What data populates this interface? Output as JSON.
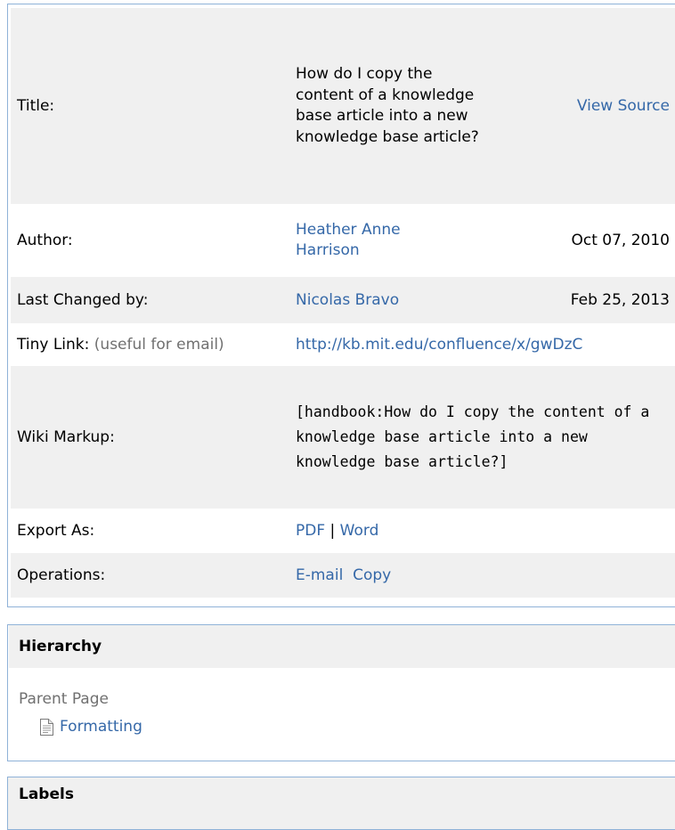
{
  "info": {
    "title_label": "Title:",
    "title_value": "How do I copy the content of a knowledge base article into a new knowledge base article?",
    "view_source": "View Source",
    "author_label": "Author:",
    "author_name": "Heather Anne Harrison",
    "author_date": "Oct 07, 2010",
    "changed_label": "Last Changed by:",
    "changed_name": "Nicolas Bravo",
    "changed_date": "Feb 25, 2013",
    "tiny_label": "Tiny Link:",
    "tiny_hint": "(useful for email)",
    "tiny_url": "http://kb.mit.edu/confluence/x/gwDzC",
    "wiki_label": "Wiki Markup:",
    "wiki_value": "[handbook:How do I copy the content of a knowledge base article into a new knowledge base article?]",
    "export_label": "Export As:",
    "export_pdf": "PDF",
    "export_sep": "|",
    "export_word": "Word",
    "ops_label": "Operations:",
    "ops_email": "E-mail",
    "ops_copy": "Copy"
  },
  "hierarchy": {
    "heading": "Hierarchy",
    "parent_label": "Parent Page",
    "parent_icon": "page-icon",
    "parent_link": "Formatting"
  },
  "labels": {
    "heading": "Labels"
  },
  "colors": {
    "link": "#3568a8",
    "row_bg": "#f0f0f0",
    "border": "#8fb2d8",
    "muted": "#707070"
  }
}
